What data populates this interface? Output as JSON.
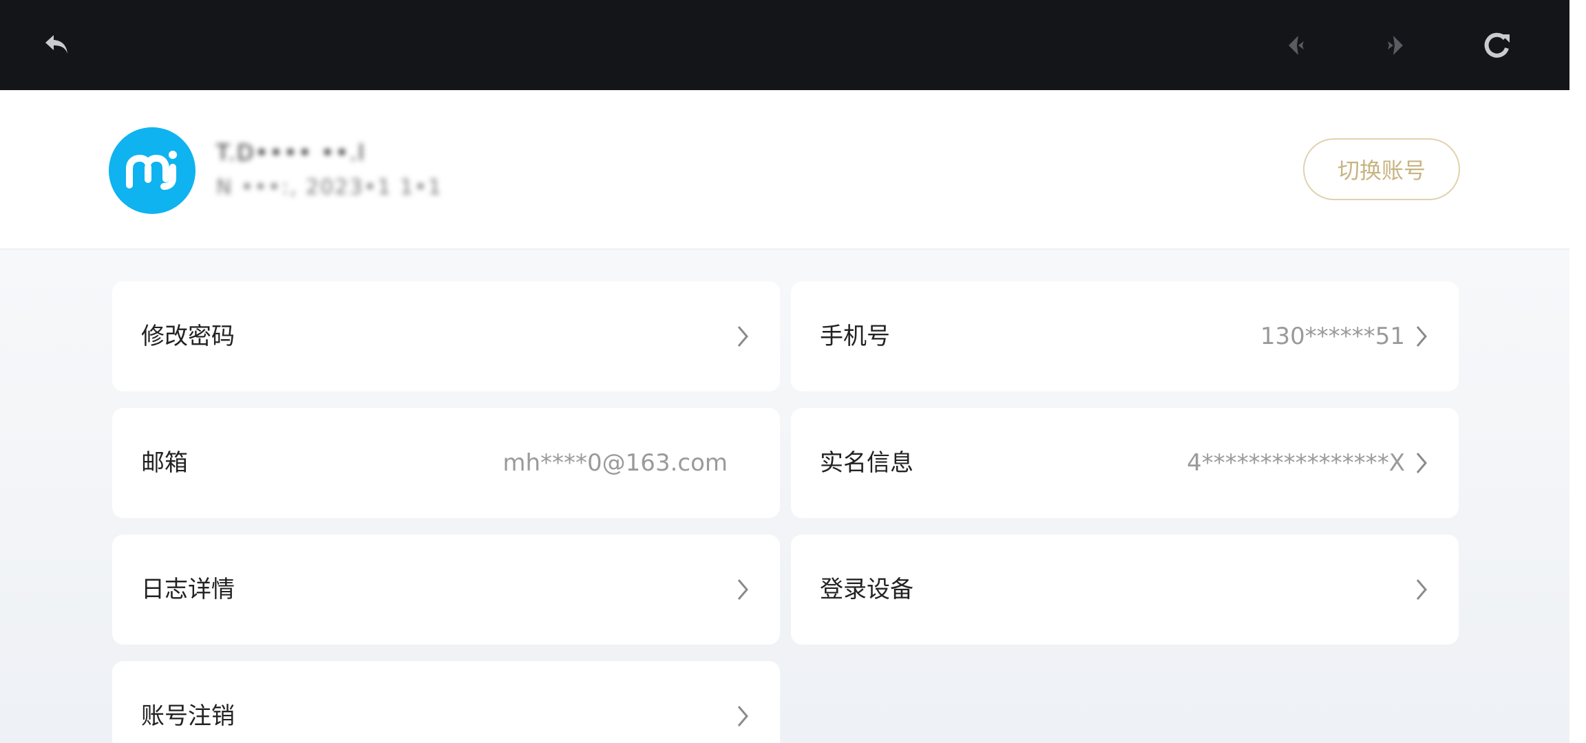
{
  "toolbar": {
    "back_icon": "back-arrow-icon",
    "prev_icon": "chevron-left-icon",
    "next_icon": "chevron-right-icon",
    "reload_icon": "reload-icon"
  },
  "account": {
    "avatar_text": "mi",
    "name": "T.D•••• ••.l",
    "subtitle": "N •••:, 2023•1 1•1",
    "switch_label": "切换账号"
  },
  "settings": {
    "change_password": {
      "label": "修改密码"
    },
    "phone": {
      "label": "手机号",
      "value": "130******51"
    },
    "email": {
      "label": "邮箱",
      "value": "mh****0@163.com"
    },
    "real_name": {
      "label": "实名信息",
      "value": "4****************X"
    },
    "log_details": {
      "label": "日志详情"
    },
    "login_devices": {
      "label": "登录设备"
    },
    "account_cancel": {
      "label": "账号注销"
    }
  },
  "colors": {
    "toolbar_bg": "#131518",
    "avatar_bg": "#0fb3f0",
    "accent_gold": "#c8b482",
    "content_bg": "#f3f5f8"
  }
}
